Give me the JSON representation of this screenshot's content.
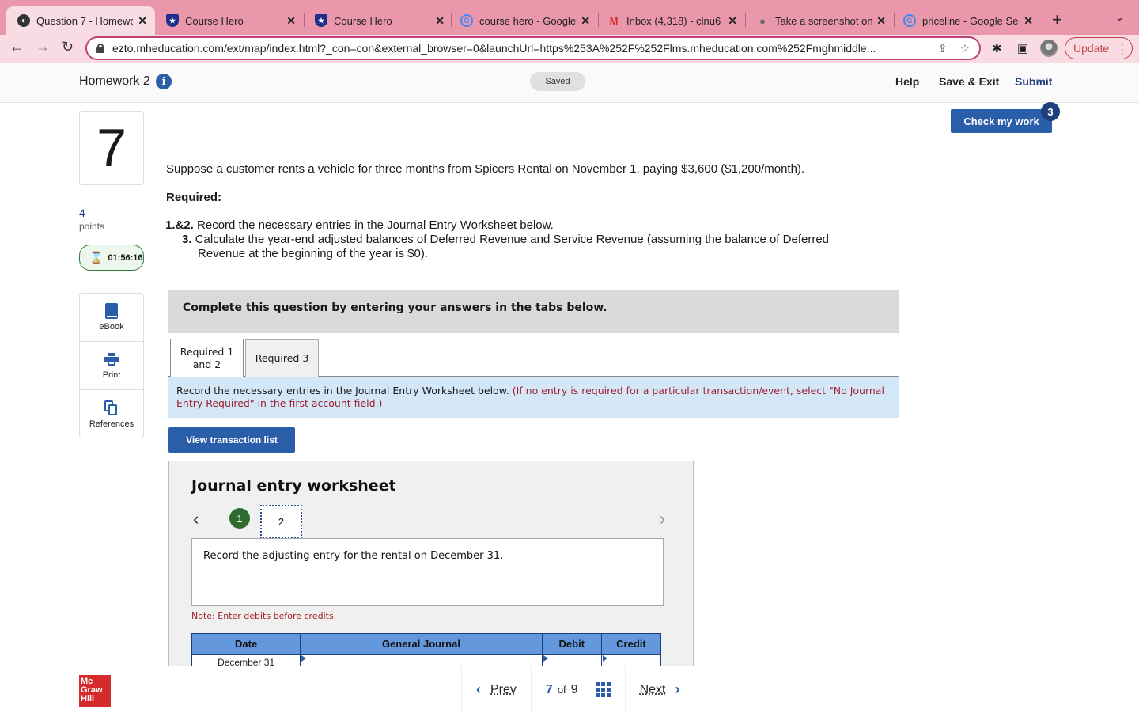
{
  "browser": {
    "tabs": [
      {
        "title": "Question 7 - Homewo",
        "favicon": "globe-icon",
        "active": true
      },
      {
        "title": "Course Hero",
        "favicon": "course-hero-shield-icon",
        "active": false
      },
      {
        "title": "Course Hero",
        "favicon": "course-hero-shield-icon",
        "active": false
      },
      {
        "title": "course hero - Google",
        "favicon": "google-icon",
        "active": false
      },
      {
        "title": "Inbox (4,318) - clnu6",
        "favicon": "gmail-icon",
        "active": false
      },
      {
        "title": "Take a screenshot on",
        "favicon": "apple-icon",
        "active": false
      },
      {
        "title": "priceline - Google Se",
        "favicon": "google-icon",
        "active": false
      }
    ],
    "url": "ezto.mheducation.com/ext/map/index.html?_con=con&external_browser=0&launchUrl=https%253A%252F%252Flms.mheducation.com%252Fmghmiddle...",
    "update_label": "Update"
  },
  "header": {
    "title": "Homework 2",
    "saved_label": "Saved",
    "help_label": "Help",
    "save_exit_label": "Save & Exit",
    "submit_label": "Submit"
  },
  "question": {
    "number": "7",
    "points_value": "4",
    "points_label": "points",
    "timer": "01:56:16",
    "check_label": "Check my work",
    "check_remaining": "3",
    "text": "Suppose a customer rents a vehicle for three months from Spicers Rental on November 1, paying $3,600 ($1,200/month).",
    "required_heading": "Required:",
    "requirements": [
      {
        "num": "1.&2.",
        "text": "Record the necessary entries in the Journal Entry Worksheet below."
      },
      {
        "num": "3.",
        "text": "Calculate the year-end adjusted balances of Deferred Revenue and Service Revenue (assuming the balance of Deferred",
        "text_cont": "Revenue at the beginning of the year is $0)."
      }
    ]
  },
  "side_tools": [
    {
      "label": "eBook",
      "icon": "book-icon"
    },
    {
      "label": "Print",
      "icon": "printer-icon"
    },
    {
      "label": "References",
      "icon": "references-icon"
    }
  ],
  "instructions": "Complete this question by entering your answers in the tabs below.",
  "answer_tabs": [
    {
      "label_line1": "Required 1",
      "label_line2": "and 2",
      "active": true
    },
    {
      "label_line1": "Required 3",
      "label_line2": "",
      "active": false
    }
  ],
  "tab_note": {
    "text": "Record the necessary entries in the Journal Entry Worksheet below.",
    "red_text": "(If no entry is required for a particular transaction/event, select \"No Journal Entry Required\" in the first account field.)"
  },
  "view_transaction_label": "View transaction list",
  "worksheet": {
    "title": "Journal entry worksheet",
    "steps": [
      "1",
      "2"
    ],
    "current_step": "2",
    "description": "Record the adjusting entry for the rental on December 31.",
    "note": "Note: Enter debits before credits.",
    "columns": [
      "Date",
      "General Journal",
      "Debit",
      "Credit"
    ],
    "rows": [
      {
        "date": "December 31",
        "account": "",
        "debit": "",
        "credit": ""
      }
    ]
  },
  "footer": {
    "brand_lines": [
      "Mc",
      "Graw",
      "Hill"
    ],
    "prev_label": "Prev",
    "current_page": "7",
    "of_label": "of",
    "total_pages": "9",
    "next_label": "Next"
  }
}
